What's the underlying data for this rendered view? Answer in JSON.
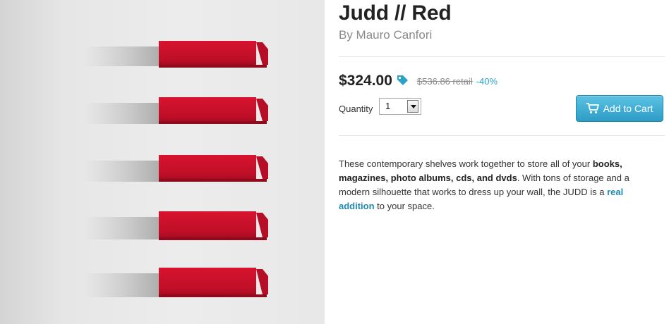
{
  "product": {
    "title": "Judd // Red",
    "byline": "By Mauro Canfori",
    "image_alt": "Five red wall shelves"
  },
  "pricing": {
    "price": "$324.00",
    "retail": "$536.86 retail",
    "discount": "-40%",
    "tag_icon": "price-tag-icon",
    "accent_color": "#2aa3c6"
  },
  "purchase": {
    "quantity_label": "Quantity",
    "quantity_value": "1",
    "add_to_cart_label": "Add to Cart",
    "cart_icon": "shopping-cart-icon",
    "button_color": "#3aaed6"
  },
  "description": {
    "t1": "These contemporary shelves work together to store all of your ",
    "b1": "books, magazines, photo albums, cds, and dvds",
    "t2": ". With tons of storage and a modern silhouette that works to dress up your wall, the JUDD is a ",
    "link": "real addition",
    "t3": " to your space."
  },
  "colors": {
    "shelf_red": "#c8102e"
  }
}
